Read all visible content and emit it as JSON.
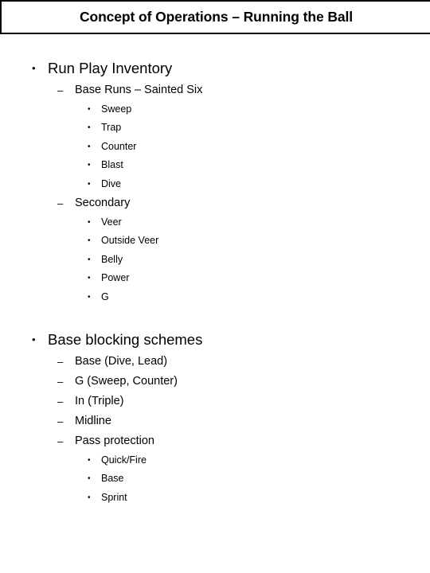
{
  "slide": {
    "title": "Concept of Operations – Running the Ball",
    "bullet_glyphs": {
      "level1": "•",
      "level2": "–",
      "level3": "•"
    },
    "groups": [
      {
        "heading": "Run Play Inventory",
        "sections": [
          {
            "heading": "Base Runs – Sainted Six",
            "items": [
              "Sweep",
              "Trap",
              "Counter",
              "Blast",
              "Dive"
            ]
          },
          {
            "heading": "Secondary",
            "items": [
              "Veer",
              "Outside Veer",
              "Belly",
              "Power",
              "G"
            ]
          }
        ]
      },
      {
        "heading": "Base blocking schemes",
        "sections": [
          {
            "heading": "Base (Dive, Lead)",
            "items": []
          },
          {
            "heading": "G (Sweep, Counter)",
            "items": []
          },
          {
            "heading": "In (Triple)",
            "items": []
          },
          {
            "heading": "Midline",
            "items": []
          },
          {
            "heading": "Pass protection",
            "items": [
              "Quick/Fire",
              "Base",
              "Sprint"
            ]
          }
        ]
      }
    ]
  }
}
